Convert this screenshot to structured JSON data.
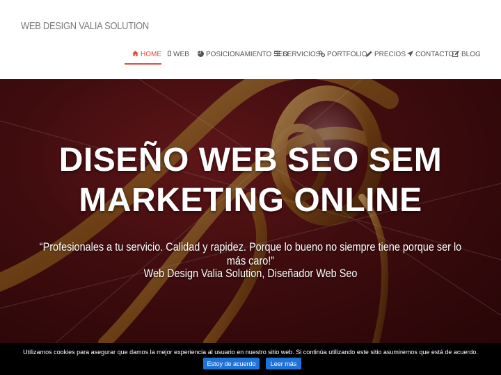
{
  "brand": "WEB DESIGN VALIA SOLUTION",
  "nav": [
    {
      "label": "HOME",
      "icon": "home-icon",
      "active": true
    },
    {
      "label": "WEB",
      "icon": "mobile-icon",
      "active": false
    },
    {
      "label": "POSICIONAMIENTO SEO",
      "icon": "pie-chart-icon",
      "active": false
    },
    {
      "label": "SERVICIOS",
      "icon": "list-icon",
      "active": false
    },
    {
      "label": "PORTFOLIO",
      "icon": "link-icon",
      "active": false
    },
    {
      "label": "PRECIOS",
      "icon": "pencil-icon",
      "active": false
    },
    {
      "label": "CONTACTO",
      "icon": "send-icon",
      "active": false
    },
    {
      "label": "BLOG",
      "icon": "edit-icon",
      "active": false
    }
  ],
  "hero": {
    "title_line1": "DISEÑO WEB SEO SEM",
    "title_line2": "MARKETING ONLINE",
    "quote": "“Profesionales a tu servicio. Calidad y rapidez. Porque lo bueno no siempre tiene porque ser lo más caro!”",
    "author": "Web Design Valia Solution, Diseñador Web Seo"
  },
  "cookie": {
    "text": "Utilizamos cookies para asegurar que damos la mejor experiencia al usuario en nuestro sitio web. Si continúa utilizando este sitio asumiremos que está de acuerdo.",
    "accept_label": "Estoy de acuerdo",
    "more_label": "Leer más"
  },
  "colors": {
    "accent": "#e14b3b",
    "cookie_button": "#1e73d8",
    "hero_bg": "#4a1012"
  }
}
